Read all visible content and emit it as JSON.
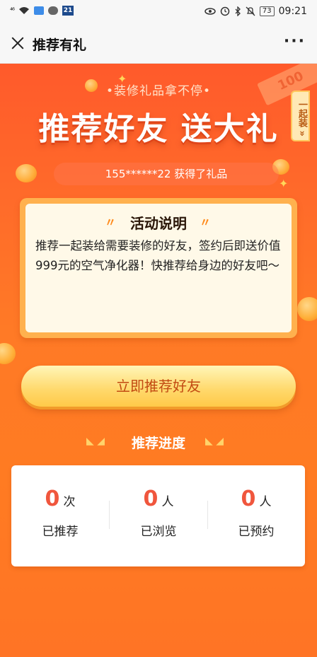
{
  "status_bar": {
    "signal": "⁴⁶",
    "news_badge": "21",
    "battery": "73",
    "time": "09:21"
  },
  "title_bar": {
    "title": "推荐有礼"
  },
  "hero": {
    "subtitle": "•装修礼品拿不停•",
    "title": "推荐好友 送大礼",
    "side_tag": "一起装 »",
    "money_text": "100"
  },
  "ticker": "155******22 获得了礼品",
  "description": {
    "heading": "活动说明",
    "body": "推荐一起装给需要装修的好友，签约后即送价值999元的空气净化器！快推荐给身边的好友吧～"
  },
  "cta_label": "立即推荐好友",
  "progress": {
    "title": "推荐进度",
    "items": [
      {
        "value": "0",
        "unit": "次",
        "label": "已推荐"
      },
      {
        "value": "0",
        "unit": "人",
        "label": "已浏览"
      },
      {
        "value": "0",
        "unit": "人",
        "label": "已预约"
      }
    ]
  },
  "colors": {
    "accent_orange": "#ff6a2a",
    "number_red": "#f0563d",
    "button_gold": "#ffd86a"
  }
}
